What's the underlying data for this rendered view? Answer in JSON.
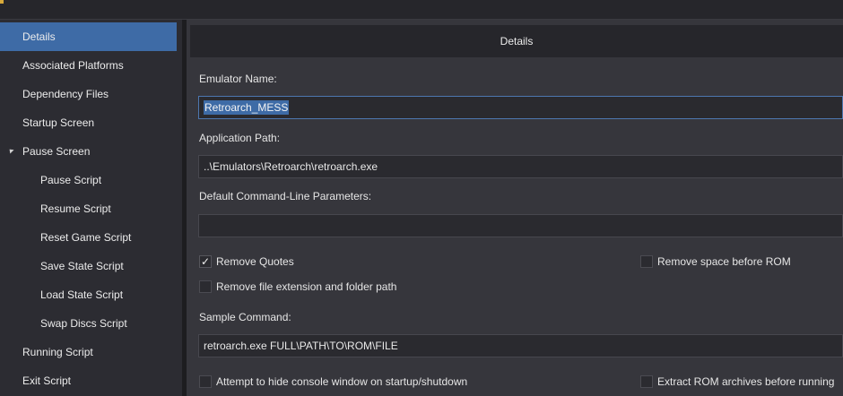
{
  "sidebar": {
    "items": [
      {
        "label": "Details",
        "selected": true
      },
      {
        "label": "Associated Platforms"
      },
      {
        "label": "Dependency Files"
      },
      {
        "label": "Startup Screen"
      },
      {
        "label": "Pause Screen",
        "expanded": true
      },
      {
        "label": "Pause Script"
      },
      {
        "label": "Resume Script"
      },
      {
        "label": "Reset Game Script"
      },
      {
        "label": "Save State Script"
      },
      {
        "label": "Load State Script"
      },
      {
        "label": "Swap Discs Script"
      },
      {
        "label": "Running Script"
      },
      {
        "label": "Exit Script"
      }
    ]
  },
  "main": {
    "header": "Details",
    "emulator_name_label": "Emulator Name:",
    "emulator_name_value": "Retroarch_MESS",
    "app_path_label": "Application Path:",
    "app_path_value": "..\\Emulators\\Retroarch\\retroarch.exe",
    "cmd_params_label": "Default Command-Line Parameters:",
    "cmd_params_value": "",
    "remove_quotes": {
      "label": "Remove Quotes",
      "checked": true
    },
    "remove_space": {
      "label": "Remove space before ROM",
      "checked": false
    },
    "remove_ext": {
      "label": "Remove file extension and folder path",
      "checked": false
    },
    "sample_cmd_label": "Sample Command:",
    "sample_cmd_value": "retroarch.exe FULL\\PATH\\TO\\ROM\\FILE",
    "hide_console": {
      "label": "Attempt to hide console window on startup/shutdown",
      "checked": false
    },
    "extract_rom": {
      "label": "Extract ROM archives before running",
      "checked": false
    }
  },
  "colors": {
    "selection": "#3e6ba6",
    "sidebar_bg": "#2c2c32",
    "content_bg": "#36363c"
  }
}
